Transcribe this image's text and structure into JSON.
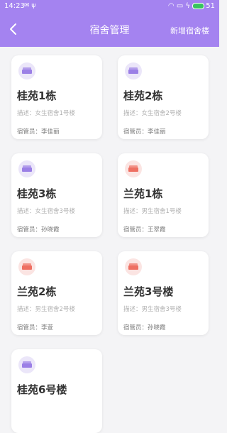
{
  "status_bar": {
    "time": "14:23",
    "icons": "✉ ψ",
    "battery": "51"
  },
  "header": {
    "title": "宿舍管理",
    "add_label": "新增宿舍楼"
  },
  "colors": {
    "accent": "#a483f0",
    "purple_icon": "#9b7fe6",
    "red_icon": "#ee6f62"
  },
  "dorms": [
    {
      "name": "桂苑1栋",
      "desc": "描述：女生宿舍1号楼",
      "manager": "宿管员：李佳丽",
      "icon": "bed-icon",
      "icon_color": "purple"
    },
    {
      "name": "桂苑2栋",
      "desc": "描述：女生宿舍2号楼",
      "manager": "宿管员：李佳丽",
      "icon": "bed-icon",
      "icon_color": "purple"
    },
    {
      "name": "桂苑3栋",
      "desc": "描述：女生宿舍3号楼",
      "manager": "宿管员：孙晓霞",
      "icon": "bed-icon",
      "icon_color": "purple"
    },
    {
      "name": "兰苑1栋",
      "desc": "描述：男生宿舍1号楼",
      "manager": "宿管员：王翠霞",
      "icon": "bed-icon",
      "icon_color": "red"
    },
    {
      "name": "兰苑2栋",
      "desc": "描述：男生宿舍2号楼",
      "manager": "宿管员：李萱",
      "icon": "bed-icon",
      "icon_color": "red"
    },
    {
      "name": "兰苑3号楼",
      "desc": "描述：男生宿舍3号楼",
      "manager": "宿管员：孙晓霞",
      "icon": "bed-icon",
      "icon_color": "red"
    },
    {
      "name": "桂苑6号楼",
      "icon": "bed-icon",
      "icon_color": "purple"
    }
  ]
}
